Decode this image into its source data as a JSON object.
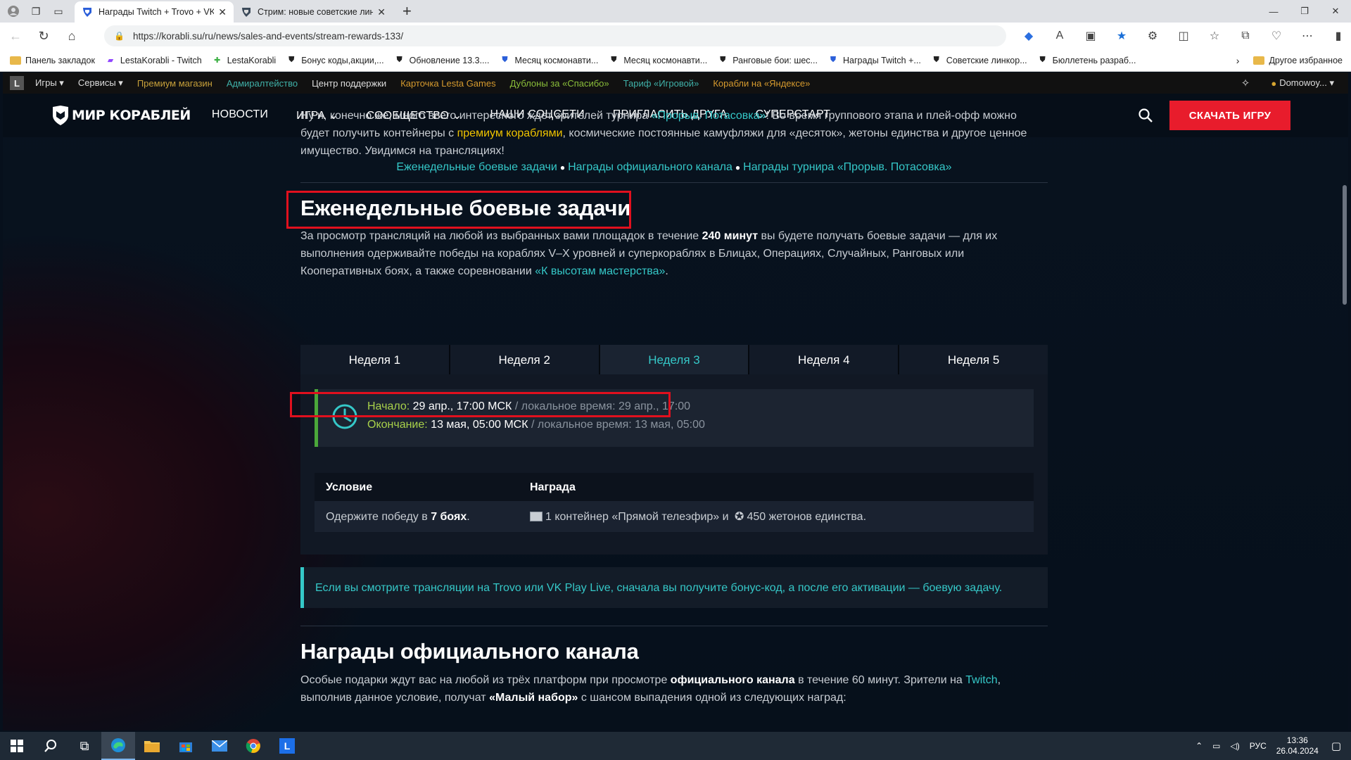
{
  "browser": {
    "tabs": [
      {
        "title": "Награды Twitch + Trovo + VK Pl",
        "active": true
      },
      {
        "title": "Стрим: новые советские линкоры",
        "active": false
      }
    ],
    "url": "https://korabli.su/ru/news/sales-and-events/stream-rewards-133/",
    "bookmarks": [
      "Панель закладок",
      "LestaKorabli - Twitch",
      "LestaKorabli",
      "Бонус коды,акции,...",
      "Обновление 13.3....",
      "Месяц космонавти...",
      "Месяц космонавти...",
      "Ранговые бои: шес...",
      "Награды Twitch +...",
      "Советские линкор...",
      "Бюллетень разраб..."
    ],
    "other_bookmarks": "Другое избранное"
  },
  "lesta_bar": {
    "items": [
      "Игры",
      "Сервисы",
      "Премиум магазин",
      "Адмиралтейство",
      "Центр поддержки",
      "Карточка Lesta Games",
      "Дублоны за «Спасибо»",
      "Тариф «Игровой»",
      "Корабли на «Яндексе»"
    ],
    "user": "Domowoy..."
  },
  "header": {
    "logo": "МИР КОРАБЛЕЙ",
    "nav": [
      "НОВОСТИ",
      "ИГРА",
      "СООБЩЕСТВО",
      "НАШИ СОЦСЕТИ",
      "ПРИГЛАСИТЬ ДРУГА",
      "СУПЕРСТАРТ"
    ],
    "download": "СКАЧАТЬ ИГРУ"
  },
  "intro": {
    "l1a": "Ну и, конечно же, много всего интересного ждет зрителей турнира ",
    "l1link": "«Прорыв. Потасовка»",
    "l1b": "! Во время группового этапа и плей-офф можно",
    "l2a": "будет получить контейнеры с ",
    "l2hl": "премиум кораблями",
    "l2b": ", космические постоянные камуфляжи для «десяток», жетоны единства и другое ценное",
    "l3": "имущество. Увидимся на трансляциях!"
  },
  "anchors": [
    "Еженедельные боевые задачи",
    "Награды официального канала",
    "Награды турнира «Прорыв. Потасовка»"
  ],
  "weekly": {
    "title": "Еженедельные боевые задачи",
    "p1a": "За просмотр трансляций на любой из выбранных вами площадок в течение ",
    "p1b": "240 минут",
    "p1c": " вы будете получать боевые задачи — для их",
    "p2": "выполнения одерживайте победы на кораблях V–X уровней и суперкораблях в Блицах, Операциях, Случайных, Ранговых или",
    "p3a": "Кооперативных боях, а также соревновании ",
    "p3link": "«К высотам мастерства»",
    "p3b": ".",
    "tabs": [
      "Неделя 1",
      "Неделя 2",
      "Неделя 3",
      "Неделя 4",
      "Неделя 5"
    ],
    "active_tab": 2,
    "start_label": "Начало:",
    "start_value": " 29 апр., 17:00 МСК",
    "start_local": " / локальное время: 29 апр., 17:00",
    "end_label": "Окончание:",
    "end_value": " 13 мая, 05:00 МСК",
    "end_local": " / локальное время: 13 мая, 05:00",
    "col_condition": "Условие",
    "col_reward": "Награда",
    "cond_a": "Одержите победу в ",
    "cond_b": "7 боях",
    "cond_c": ".",
    "reward": "1 контейнер «Прямой телеэфир» и",
    "reward_b": "450 жетонов единства."
  },
  "notice": "Если вы смотрите трансляции на Trovo или VK Play Live, сначала вы получите бонус-код, а после его активации — боевую задачу.",
  "official": {
    "title": "Награды официального канала",
    "p1a": "Особые подарки ждут вас на любой из трёх платформ при просмотре ",
    "p1b": "официального канала",
    "p1c": " в течение 60 минут. Зрители на ",
    "p1link": "Twitch",
    "p1d": ",",
    "p2a": "выполнив данное условие, получат ",
    "p2b": "«Малый набор»",
    "p2c": " с шансом выпадения одной из следующих наград:"
  },
  "taskbar": {
    "lang": "РУС",
    "time": "13:36",
    "date": "26.04.2024"
  }
}
